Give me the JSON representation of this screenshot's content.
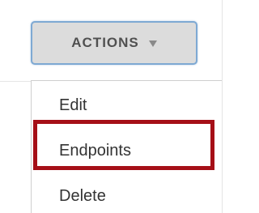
{
  "actions_button": {
    "label": "ACTIONS",
    "icon": "caret-down-icon"
  },
  "menu": {
    "items": [
      {
        "label": "Edit"
      },
      {
        "label": "Endpoints"
      },
      {
        "label": "Delete"
      }
    ],
    "highlighted_item": "Endpoints"
  },
  "colors": {
    "highlight_border": "#a50f17",
    "button_bg": "#dcdcdc",
    "button_border": "#7ea9d3",
    "text": "#333333"
  }
}
